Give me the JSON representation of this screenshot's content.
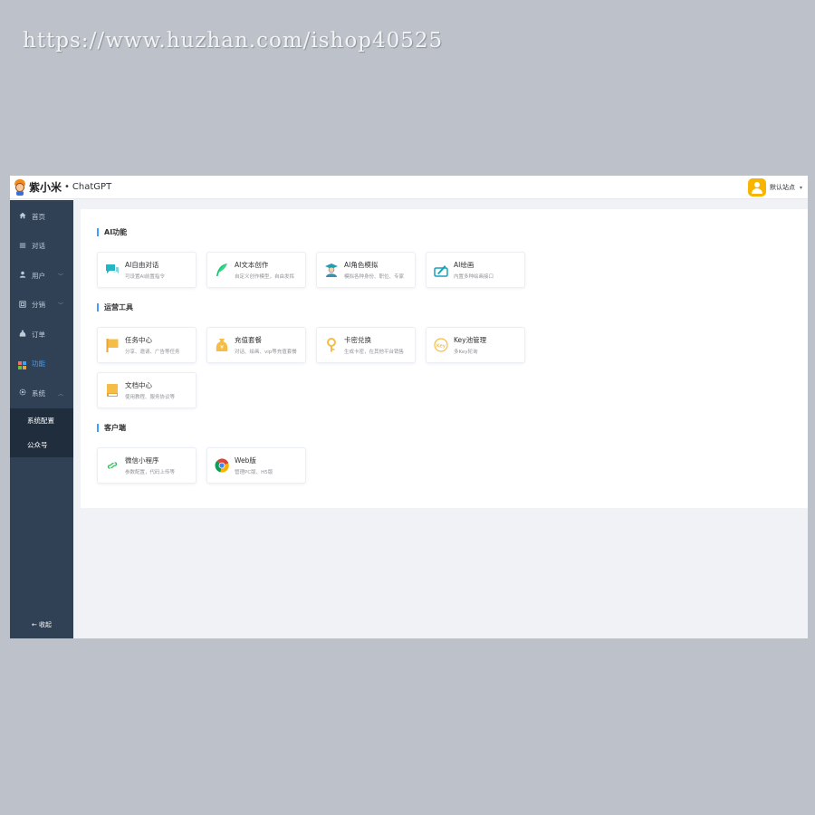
{
  "watermark": "https://www.huzhan.com/ishop40525",
  "header": {
    "brand_name": "紫小米",
    "brand_separator": "•",
    "brand_sub": "ChatGPT",
    "user_name": "默认站点",
    "user_caret": "▾"
  },
  "sidebar": {
    "items": [
      {
        "label": "首页",
        "icon": "home-icon"
      },
      {
        "label": "对话",
        "icon": "menu-lines-icon"
      },
      {
        "label": "用户",
        "icon": "user-icon",
        "chevron": "﹀"
      },
      {
        "label": "分销",
        "icon": "share-icon",
        "chevron": "﹀"
      },
      {
        "label": "订单",
        "icon": "money-bag-icon"
      },
      {
        "label": "功能",
        "icon": "grid-icon"
      },
      {
        "label": "系统",
        "icon": "gear-icon",
        "chevron": "︿"
      }
    ],
    "sub_items": [
      {
        "label": "系统配置"
      },
      {
        "label": "公众号"
      }
    ],
    "collapse_label": "← 收起"
  },
  "sections": [
    {
      "title": "AI功能",
      "cards": [
        {
          "title": "AI自由对话",
          "desc": "可设置AI前置指令",
          "icon": "chat-bubble-icon",
          "color": "#26b4c4"
        },
        {
          "title": "AI文本创作",
          "desc": "自定义创作模型，自由发挥",
          "icon": "feather-icon",
          "color": "#13c26b"
        },
        {
          "title": "AI角色模拟",
          "desc": "模拟各种身份、职位、专家",
          "icon": "graduate-icon",
          "color": "#1f9fb0"
        },
        {
          "title": "AI绘画",
          "desc": "内置多种绘画接口",
          "icon": "drawing-board-icon",
          "color": "#1aa0b8"
        }
      ]
    },
    {
      "title": "运营工具",
      "cards": [
        {
          "title": "任务中心",
          "desc": "分享、邀请、广告等任务",
          "icon": "flag-icon",
          "color": "#f5bd45"
        },
        {
          "title": "充值套餐",
          "desc": "对话、绘画、vip等充值套餐",
          "icon": "money-bag-icon",
          "color": "#f5bd45"
        },
        {
          "title": "卡密兑换",
          "desc": "生成卡密，在其他平台销售",
          "icon": "key-icon",
          "color": "#f5bd45"
        },
        {
          "title": "Key池管理",
          "desc": "多Key轮询",
          "icon": "key-circle-icon",
          "color": "#f5bd45"
        },
        {
          "title": "文档中心",
          "desc": "使用教程、服务协议等",
          "icon": "book-icon",
          "color": "#f5bd45"
        }
      ]
    },
    {
      "title": "客户端",
      "cards": [
        {
          "title": "微信小程序",
          "desc": "参数配置，代码上传等",
          "icon": "miniprogram-icon",
          "color": "#2ac256"
        },
        {
          "title": "Web版",
          "desc": "管理PC版、H5版",
          "icon": "chrome-icon",
          "color": "#db4437"
        }
      ]
    }
  ],
  "colors": {
    "sidebar_bg": "#304156",
    "sidebar_sub_bg": "#1f2d3d",
    "accent": "#409eff",
    "page_bg": "#f0f2f5"
  }
}
